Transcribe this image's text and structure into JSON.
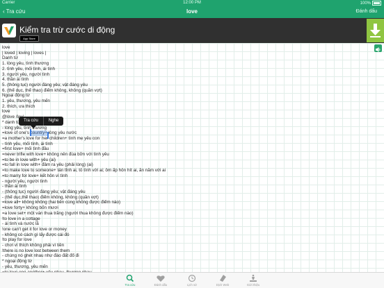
{
  "status": {
    "carrier": "Carrier",
    "time": "12:00 PM",
    "battery": "100%"
  },
  "nav": {
    "back_label": "Tra cứu",
    "title": "love",
    "bookmark_label": "Đánh dấu"
  },
  "ad": {
    "title": "Kiểm tra trừ cước di động",
    "store_label": "App Store"
  },
  "popup": {
    "lookup": "Tra cứu",
    "listen": "Nghe"
  },
  "lines": [
    "love",
    "| loved | loving | loves |",
    "Danh từ",
    "1. lòng yêu, tình thương",
    "2. tình yêu, mối tình, ái tình",
    "3. người yêu, người tình",
    "4. thần ái tình",
    "5. (thông tục) người đáng yêu; vật đáng yêu",
    "6. (thể dục, thể thao) điểm không, không (quần vợt)",
    "Ngoại động từ",
    "1. yêu, thương, yêu mến",
    "2. thích, ưa thích",
    "love",
    "@love /lʌv/",
    "*  danh từ",
    "- lòng yêu, tình thương",
    "=love of one's country+ lòng yêu nước",
    "=a mother's love for her children+ tình mẹ yêu con",
    "- tình yêu, mối tình, ái tình",
    "=first love+ mối tình đầu",
    "=never trifle with love+ không nên đùa bỡn với tình yêu",
    "=to be in love with+ yêu (ai)",
    "=to fall in love with+ đâm ra yêu (phải lòng) (ai)",
    "=to make love to someone+ tán tỉnh ai, tỏ tình với ai; ôm ấp hôn hít ai, ăn nằm với ai",
    "=to marry for love+ kết hôn vì tình",
    "- người yêu, người tình",
    "- thần ái tình",
    "- (thông tục) người đáng yêu; vật đáng yêu",
    "- (thể dục,thể thao) điểm không, không (quần vợt)",
    "=love all+ không không (hai bên cùng không được điểm nào)",
    "=love forty+ không bốn mươi",
    "=a love set+ một ván thua trắng (người thua không được điểm nào)",
    "!to love in a cottage",
    "- ái tình và nước lã",
    "!one can't get it for love or money",
    "- không có cách gì lấy được cái đó",
    "!to play for love",
    "- chơi vì thích không phải vì tiền",
    "!there is no love lost between them",
    "- chúng nó ghét nhau như đào đất đổ đi",
    "*  ngoại động từ",
    "- yêu, thương, yêu mến",
    "=to love one another+ yêu nhau, thương nhau"
  ],
  "tabs": [
    {
      "label": "Tra cứu",
      "icon": "search-icon",
      "active": true
    },
    {
      "label": "Đánh dấu",
      "icon": "heart-icon",
      "active": false
    },
    {
      "label": "Lịch sử",
      "icon": "clock-icon",
      "active": false
    },
    {
      "label": "Dịch Web",
      "icon": "globe-icon",
      "active": false
    },
    {
      "label": "Giới thiệu",
      "icon": "info-icon",
      "active": false
    }
  ],
  "colors": {
    "header": "#1fa36e",
    "active_tab": "#1fa36e",
    "download": "#8fc541",
    "banner": "#303030"
  }
}
